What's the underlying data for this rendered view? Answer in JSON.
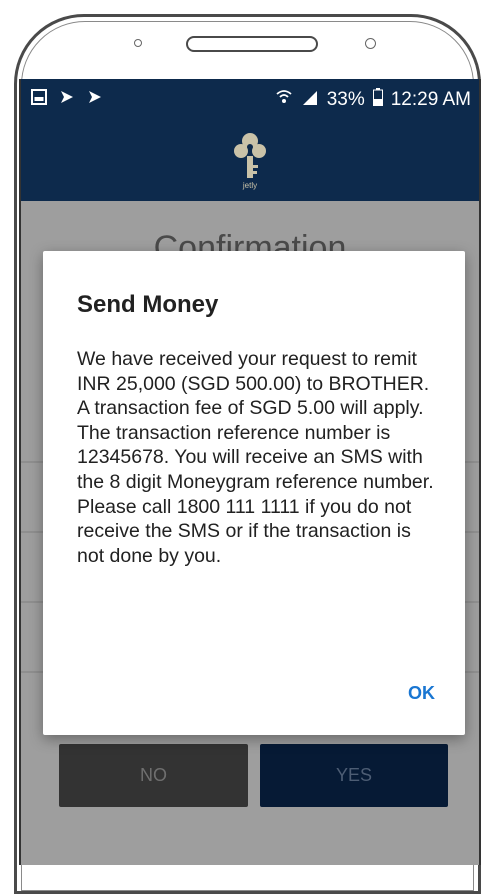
{
  "status_bar": {
    "battery": "33%",
    "time": "12:29 AM",
    "left_icons": [
      "gallery-icon",
      "cast-icon",
      "cast-icon"
    ],
    "right_icons": [
      "wifi-icon",
      "signal-icon",
      "battery-icon"
    ]
  },
  "app_bar": {
    "logo_text": "jetly"
  },
  "background": {
    "title": "Confirmation",
    "no_label": "NO",
    "yes_label": "YES"
  },
  "dialog": {
    "title": "Send Money",
    "message": "We have received your request to remit INR 25,000 (SGD 500.00) to BROTHER. A transaction fee of SGD 5.00 will apply. The transaction reference number is 12345678. You will receive an SMS with the 8 digit Moneygram reference number. Please call 1800 111 1111 if you do not receive the SMS or if the transaction is not done by you.",
    "ok_label": "OK"
  },
  "colors": {
    "app_bar": "#0d2a4c",
    "accent": "#1976d2",
    "scrim": "#9e9e9e"
  }
}
